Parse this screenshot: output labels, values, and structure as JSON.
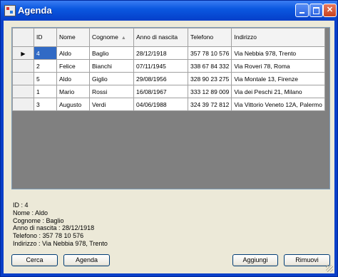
{
  "window": {
    "title": "Agenda"
  },
  "grid": {
    "columns": [
      "ID",
      "Nome",
      "Cognome",
      "Anno di nascita",
      "Telefono",
      "Indirizzo"
    ],
    "sorted_column": "Cognome",
    "current_row_marker": "▶",
    "rows": [
      [
        "4",
        "Aldo",
        "Baglio",
        "28/12/1918",
        "357 78 10 576",
        "Via Nebbia 978, Trento"
      ],
      [
        "2",
        "Felice",
        "Bianchi",
        "07/11/1945",
        "338 67 84 332",
        "Via Roveri 78, Roma"
      ],
      [
        "5",
        "Aldo",
        "Giglio",
        "29/08/1956",
        "328 90 23 275",
        "Via Montale 13, Firenze"
      ],
      [
        "1",
        "Mario",
        "Rossi",
        "16/08/1967",
        "333 12 89 009",
        "Via dei Peschi 21, Milano"
      ],
      [
        "3",
        "Augusto",
        "Verdi",
        "04/06/1988",
        "324 39 72 812",
        "Via Vittorio Veneto 12A, Palermo"
      ]
    ]
  },
  "details": [
    "ID : 4",
    "Nome : Aldo",
    "Cognome : Baglio",
    "Anno di nascita : 28/12/1918",
    "Telefono : 357 78 10 576",
    "Indirizzo : Via Nebbia 978, Trento"
  ],
  "buttons": {
    "cerca": "Cerca",
    "agenda": "Agenda",
    "aggiungi": "Aggiungi",
    "rimuovi": "Rimuovi"
  },
  "colors": {
    "title_bar": "#0a54e3",
    "selection": "#316ac5",
    "grid_background": "#808080",
    "form_background": "#ece9d8"
  }
}
